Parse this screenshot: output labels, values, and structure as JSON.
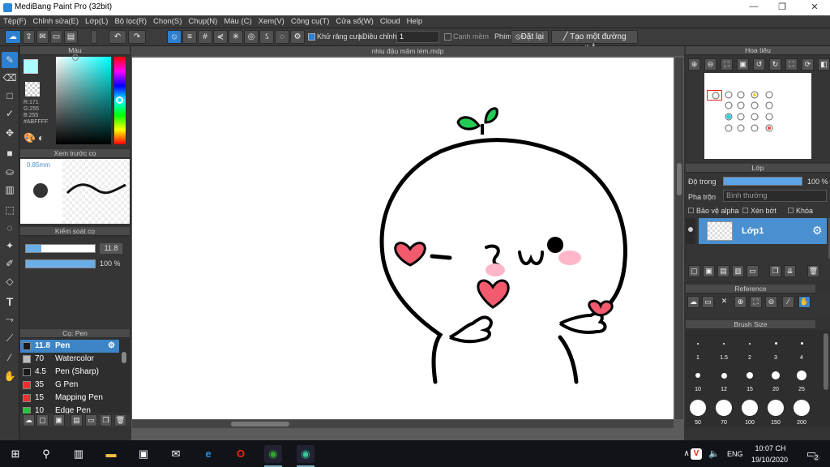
{
  "window": {
    "title": "MediBang Paint Pro (32bit)",
    "min": "—",
    "max": "❐",
    "close": "✕"
  },
  "menu": [
    "Tệp(F)",
    "Chỉnh sửa(E)",
    "Lớp(L)",
    "Bộ lọc(R)",
    "Chọn(S)",
    "Chụp(N)",
    "Màu (C)",
    "Xem(V)",
    "Công cụ(T)",
    "Cửa sổ(W)",
    "Cloud",
    "Help"
  ],
  "toolbar": {
    "antialias_label": "Khử răng cưa",
    "adjust_label": "Điều chỉnh",
    "adjust_value": "1",
    "edge_label": "Cạnh mềm",
    "phim_label": "Phím",
    "reset_label": "Đặt lại",
    "straight_line_label": "Tạo một đường thẳng"
  },
  "color_panel": {
    "title": "Màu",
    "r": "R:171",
    "g": "G:255",
    "b": "B:255",
    "hex": "#ABFFFF",
    "fg_color": "#abffff"
  },
  "brush_preview": {
    "title": "Xem trước cọ",
    "size_label": "0.85mm"
  },
  "brush_control": {
    "title": "Kiểm soát cọ",
    "size_value": "11.8",
    "opacity_value": "100 %"
  },
  "brush_list": {
    "title": "Cọ: Pen",
    "items": [
      {
        "size": "11.8",
        "name": "Pen",
        "color": "#1a1a1a",
        "selected": true
      },
      {
        "size": "70",
        "name": "Watercolor",
        "color": "#bbbbbb"
      },
      {
        "size": "4.5",
        "name": "Pen (Sharp)",
        "color": "#1a1a1a"
      },
      {
        "size": "35",
        "name": "G Pen",
        "color": "#e83030"
      },
      {
        "size": "15",
        "name": "Mapping Pen",
        "color": "#e83030"
      },
      {
        "size": "10",
        "name": "Edge Pen",
        "color": "#30c040"
      }
    ]
  },
  "document": {
    "tab_title": "nhiu đậu mãm lém.mdp"
  },
  "navigator": {
    "title": "Hoa tiêu"
  },
  "layer_panel": {
    "title": "Lớp",
    "opacity_label": "Độ trong",
    "opacity_value": "100 %",
    "opacity_fraction": 1.0,
    "blend_label": "Pha trộn",
    "blend_value": "Bình thường",
    "protect_alpha": "Bảo vệ alpha",
    "clipping": "Xén bớt",
    "lock": "Khóa",
    "layer_name": "Lớp1"
  },
  "reference": {
    "title": "Reference"
  },
  "brush_size": {
    "title": "Brush Size",
    "sizes": [
      "1",
      "1.5",
      "2",
      "3",
      "4",
      "10",
      "12",
      "15",
      "20",
      "25",
      "50",
      "70",
      "100",
      "150",
      "200"
    ]
  },
  "taskbar": {
    "lang": "ENG",
    "time": "10:07 CH",
    "date": "19/10/2020",
    "notif_count": "2"
  }
}
